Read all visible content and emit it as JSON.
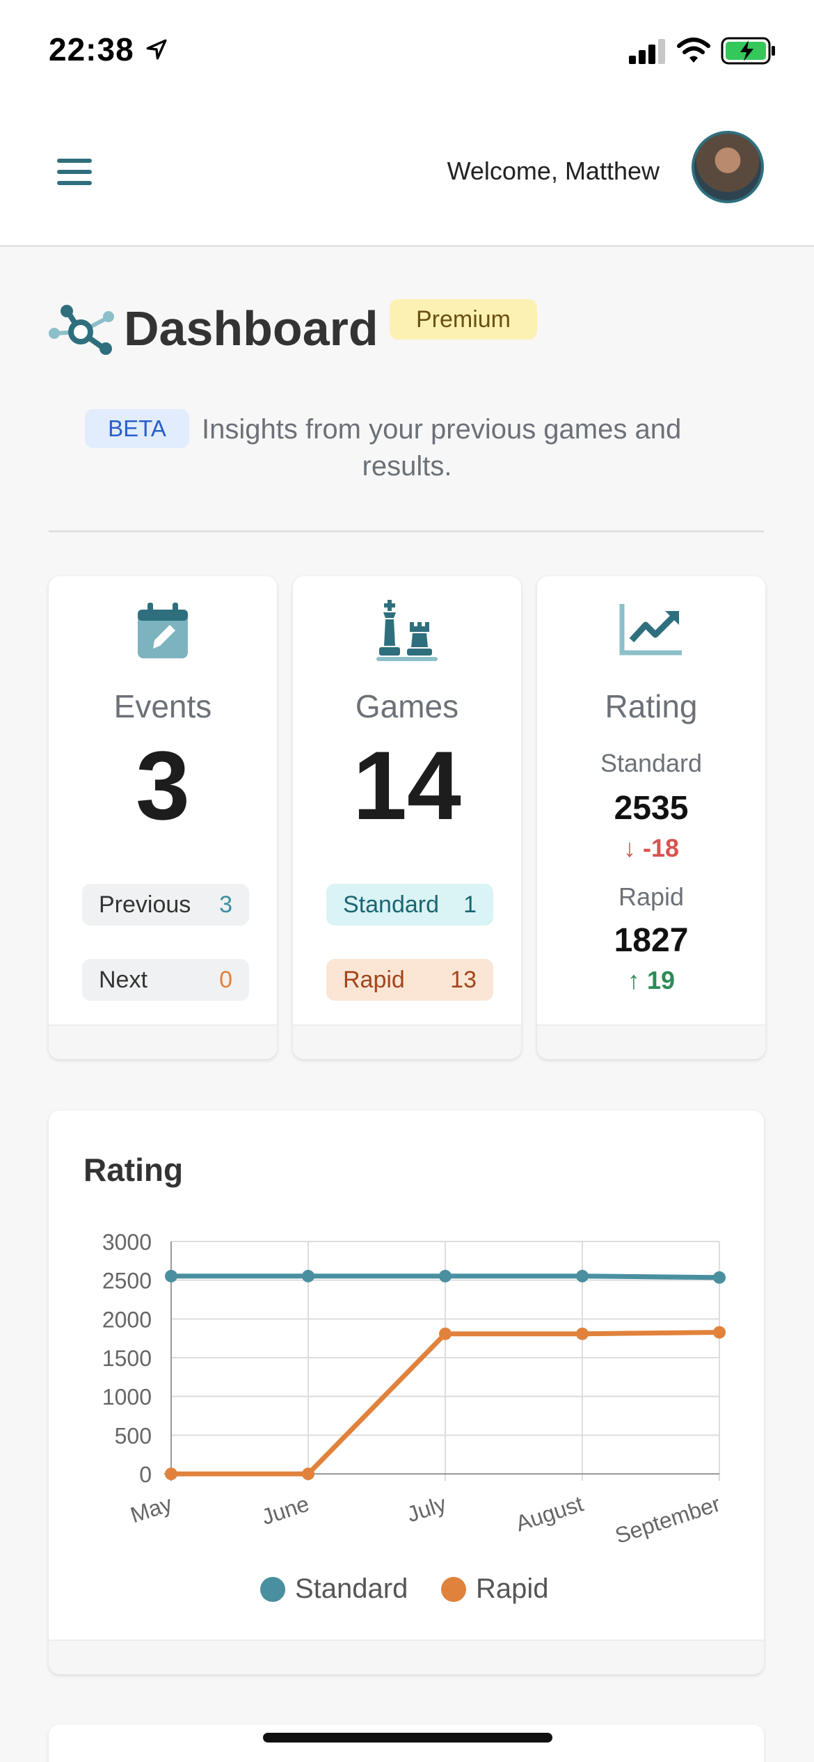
{
  "status_bar": {
    "time": "22:38",
    "icons": [
      "location-arrow-icon",
      "cellular-signal-icon",
      "wifi-icon",
      "battery-charging-icon"
    ]
  },
  "header": {
    "menu_icon": "hamburger-menu-icon",
    "welcome": "Welcome, Matthew"
  },
  "title": {
    "text": "Dashboard",
    "badge": "Premium",
    "icon": "network-nodes-icon"
  },
  "intro": {
    "badge": "BETA",
    "text_line1": "Insights from your previous games and",
    "text_line2": "results."
  },
  "cards": {
    "events": {
      "icon": "calendar-edit-icon",
      "title": "Events",
      "value": "3",
      "previous_label": "Previous",
      "previous_value": "3",
      "next_label": "Next",
      "next_value": "0"
    },
    "games": {
      "icon": "chess-pieces-icon",
      "title": "Games",
      "value": "14",
      "standard_label": "Standard",
      "standard_value": "1",
      "rapid_label": "Rapid",
      "rapid_value": "13"
    },
    "rating": {
      "icon": "chart-line-up-icon",
      "title": "Rating",
      "standard_label": "Standard",
      "standard_value": "2535",
      "standard_delta": "-18",
      "rapid_label": "Rapid",
      "rapid_value": "1827",
      "rapid_delta": "19"
    }
  },
  "colors": {
    "teal": "#4a8fa0",
    "orange": "#e0823c",
    "down": "#d9534f",
    "up": "#2e8b57"
  },
  "chart_data": {
    "type": "line",
    "title": "Rating",
    "categories": [
      "May",
      "June",
      "July",
      "August",
      "September"
    ],
    "series": [
      {
        "name": "Standard",
        "color": "#4a8fa0",
        "values": [
          2553,
          2553,
          2553,
          2553,
          2535
        ]
      },
      {
        "name": "Rapid",
        "color": "#e0823c",
        "values": [
          0,
          0,
          1808,
          1808,
          1827
        ]
      }
    ],
    "y_ticks": [
      0,
      500,
      1000,
      1500,
      2000,
      2500,
      3000
    ],
    "ylim": [
      0,
      3000
    ],
    "grid": true,
    "legend": "bottom"
  }
}
